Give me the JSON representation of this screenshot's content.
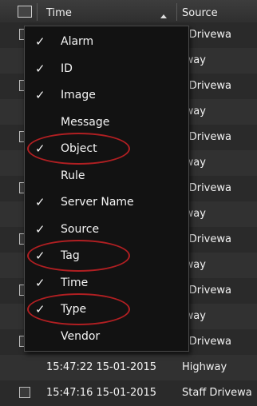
{
  "header": {
    "time_label": "Time",
    "source_label": "Source"
  },
  "rows": [
    {
      "time": "",
      "source": "f Drivewa"
    },
    {
      "time": "",
      "source": "lway"
    },
    {
      "time": "",
      "source": "f Drivewa"
    },
    {
      "time": "",
      "source": "lway"
    },
    {
      "time": "",
      "source": "f Drivewa"
    },
    {
      "time": "",
      "source": "lway"
    },
    {
      "time": "",
      "source": "f Drivewa"
    },
    {
      "time": "",
      "source": "lway"
    },
    {
      "time": "",
      "source": "f Drivewa"
    },
    {
      "time": "",
      "source": "lway"
    },
    {
      "time": "",
      "source": "f Drivewa"
    },
    {
      "time": "",
      "source": "lway"
    },
    {
      "time": "",
      "source": "f Drivewa"
    },
    {
      "time": "15:47:22 15-01-2015",
      "source": "Highway"
    },
    {
      "time": "15:47:16 15-01-2015",
      "source": "Staff Drivewa"
    }
  ],
  "menu": {
    "items": [
      {
        "label": "Alarm",
        "checked": true,
        "highlighted": false
      },
      {
        "label": "ID",
        "checked": true,
        "highlighted": false
      },
      {
        "label": "Image",
        "checked": true,
        "highlighted": false
      },
      {
        "label": "Message",
        "checked": false,
        "highlighted": false
      },
      {
        "label": "Object",
        "checked": true,
        "highlighted": true
      },
      {
        "label": "Rule",
        "checked": false,
        "highlighted": false
      },
      {
        "label": "Server Name",
        "checked": true,
        "highlighted": false
      },
      {
        "label": "Source",
        "checked": true,
        "highlighted": false
      },
      {
        "label": "Tag",
        "checked": true,
        "highlighted": true
      },
      {
        "label": "Time",
        "checked": true,
        "highlighted": false
      },
      {
        "label": "Type",
        "checked": true,
        "highlighted": true
      },
      {
        "label": "Vendor",
        "checked": false,
        "highlighted": false
      }
    ],
    "check_glyph": "✓",
    "highlight_color": "#b01f22"
  }
}
